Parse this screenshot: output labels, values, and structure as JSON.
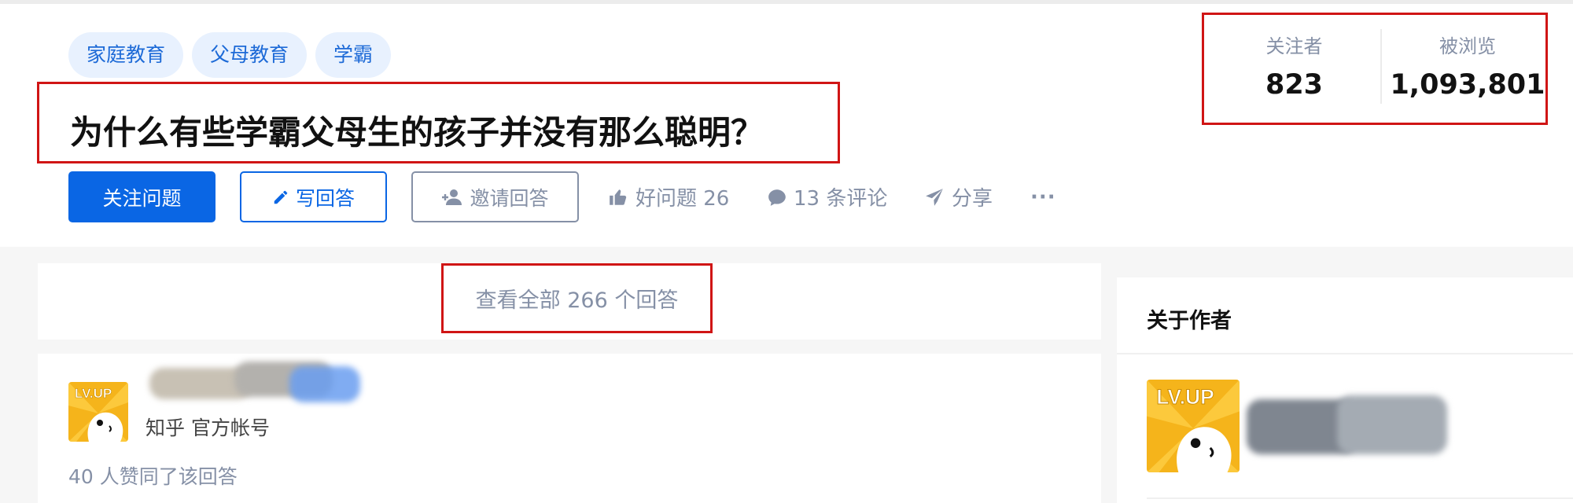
{
  "tags": [
    "家庭教育",
    "父母教育",
    "学霸"
  ],
  "question": {
    "title": "为什么有些学霸父母生的孩子并没有那么聪明？"
  },
  "stats": {
    "followers_label": "关注者",
    "followers_value": "823",
    "views_label": "被浏览",
    "views_value": "1,093,801"
  },
  "actions": {
    "follow_label": "关注问题",
    "answer_label": "写回答",
    "invite_label": "邀请回答",
    "good_question_label": "好问题 26",
    "comments_label": "13 条评论",
    "share_label": "分享",
    "more_label": "···"
  },
  "answers": {
    "view_all_label": "查看全部 266 个回答"
  },
  "answer": {
    "author_badge": "知乎 官方帐号",
    "agree_text": "40 人赞同了该回答"
  },
  "sidebar": {
    "about_author_title": "关于作者"
  },
  "colors": {
    "brand": "#0a66e4",
    "highlight_border": "#d01515",
    "muted": "#8590a6"
  },
  "icons": [
    "pencil-icon",
    "add-user-icon",
    "thumbs-up-icon",
    "comment-icon",
    "paper-plane-icon",
    "more-icon"
  ]
}
